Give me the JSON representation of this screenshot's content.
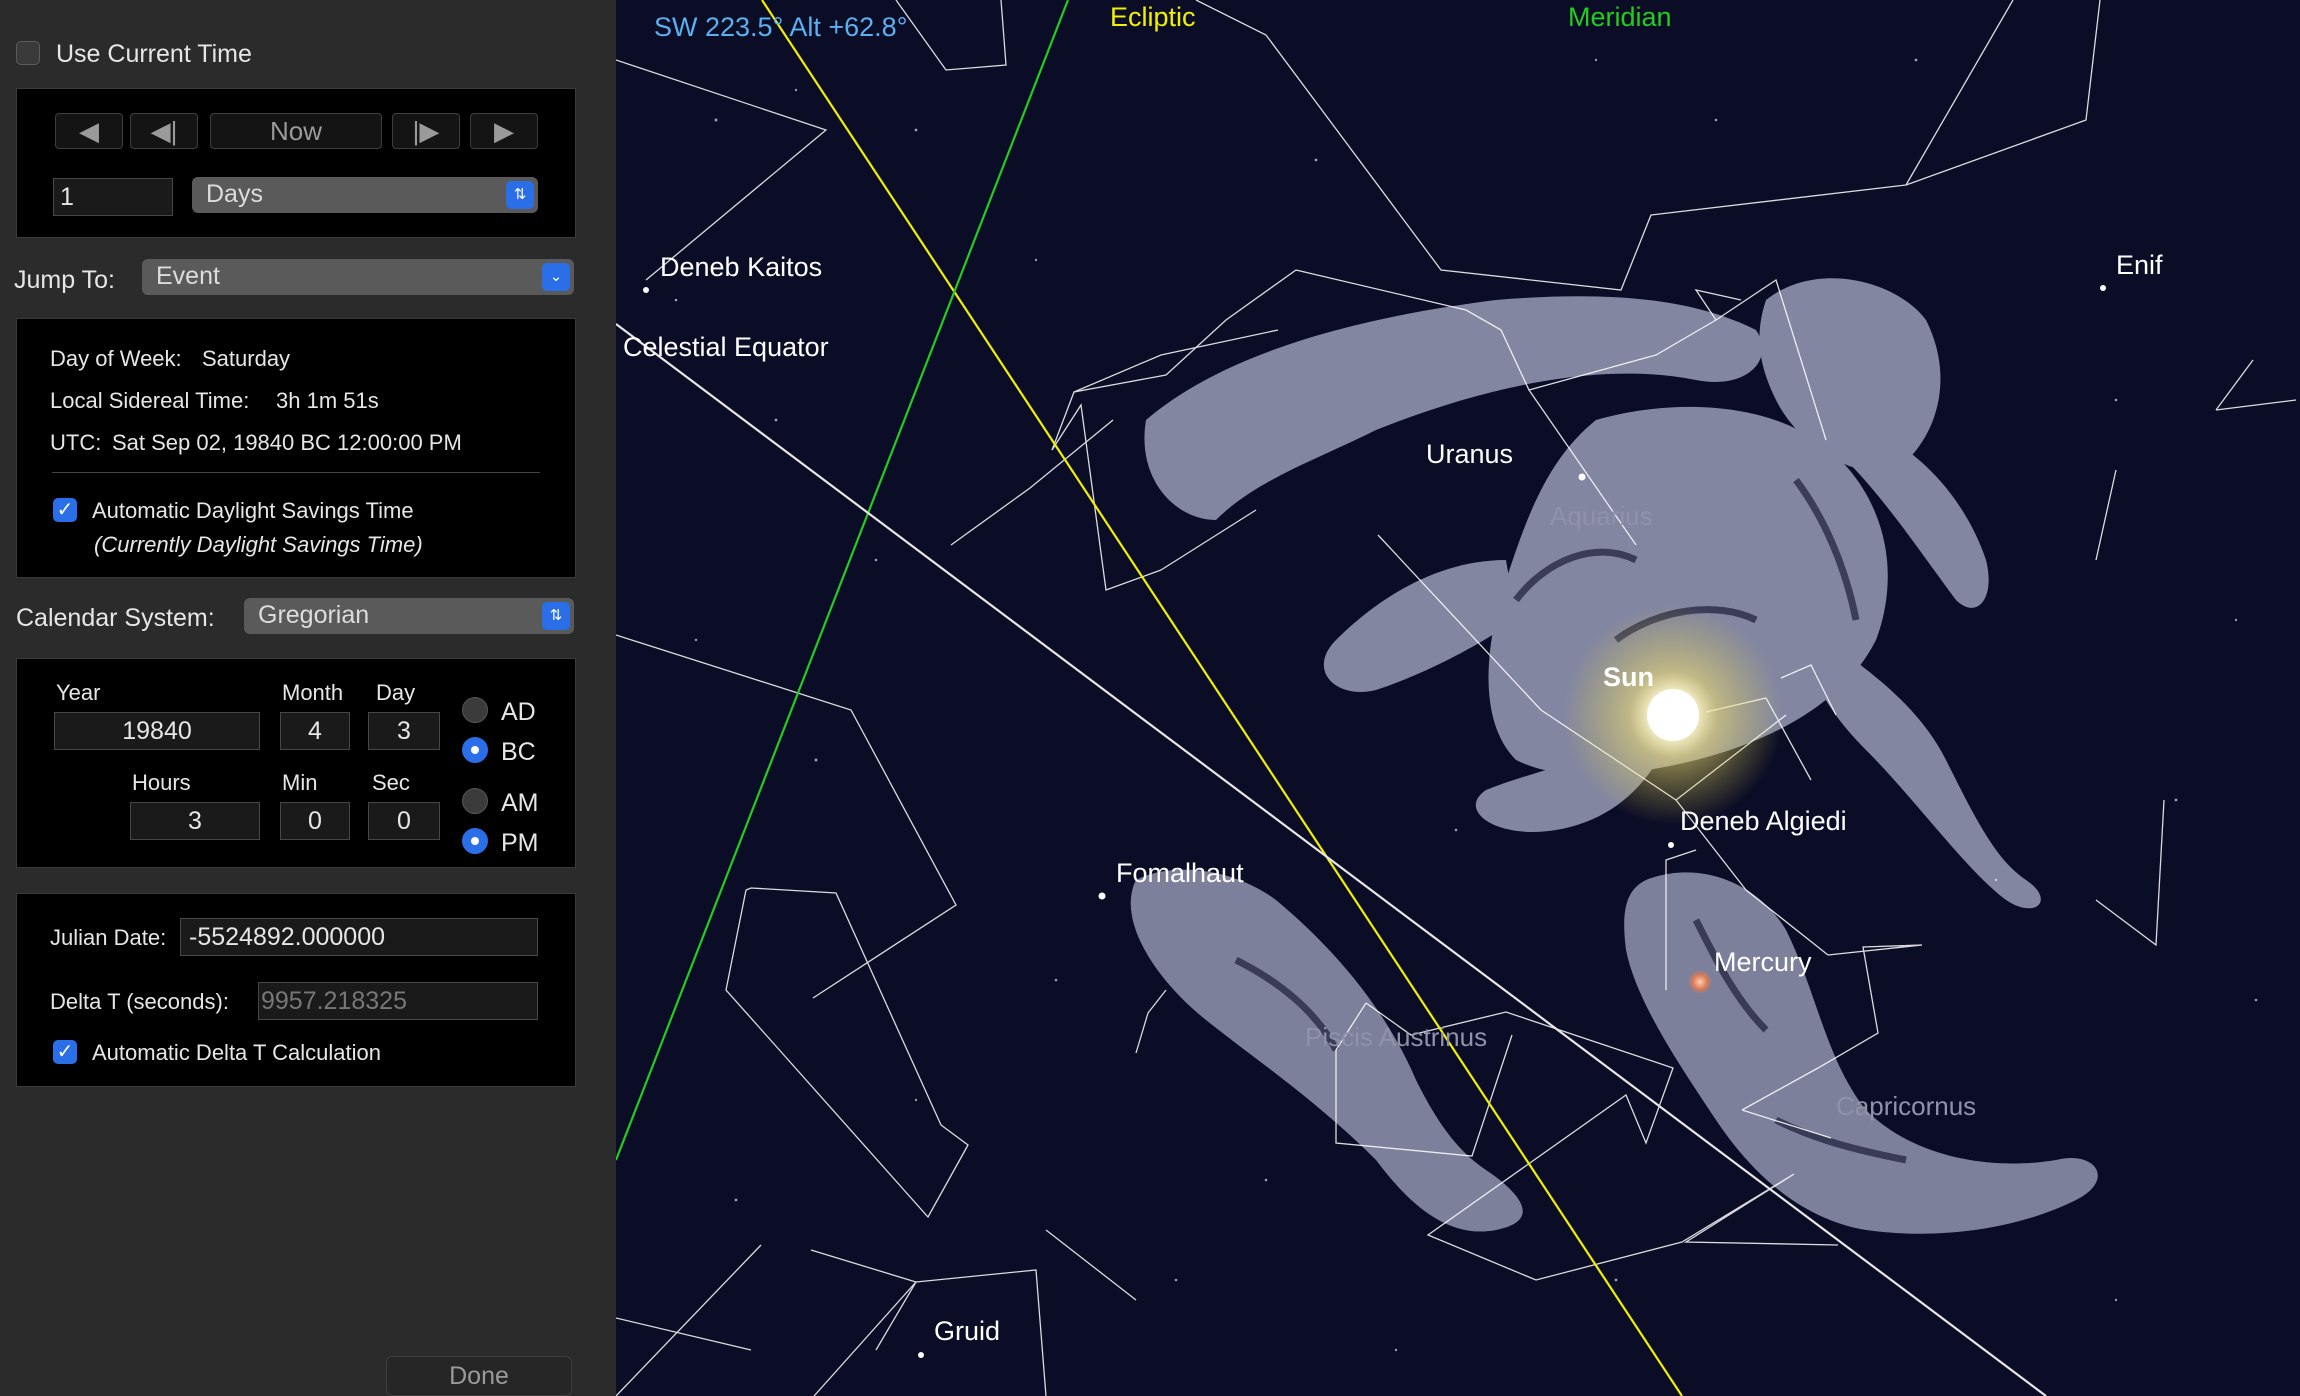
{
  "sidebar": {
    "use_current_time": "Use Current Time",
    "stepper": {
      "now_label": "Now",
      "step_value": "1",
      "step_unit": "Days"
    },
    "jump_to": {
      "label": "Jump To:",
      "value": "Event"
    },
    "info": {
      "day_of_week_label": "Day of Week:",
      "day_of_week": "Saturday",
      "lst_label": "Local Sidereal Time:",
      "lst": "3h 1m 51s",
      "utc_label": "UTC:",
      "utc": "Sat Sep 02, 19840 BC 12:00:00 PM",
      "auto_dst_label": "Automatic Daylight Savings Time",
      "dst_status": "(Currently Daylight Savings Time)"
    },
    "calendar": {
      "label": "Calendar System:",
      "value": "Gregorian"
    },
    "date": {
      "year_label": "Year",
      "year": "19840",
      "month_label": "Month",
      "month": "4",
      "day_label": "Day",
      "day": "3",
      "hours_label": "Hours",
      "hours": "3",
      "min_label": "Min",
      "min": "0",
      "sec_label": "Sec",
      "sec": "0",
      "ad": "AD",
      "bc": "BC",
      "am": "AM",
      "pm": "PM"
    },
    "julian": {
      "label": "Julian Date:",
      "value": "-5524892.000000",
      "delta_t_label": "Delta T (seconds):",
      "delta_t_value": "9957.218325",
      "auto_delta_label": "Automatic Delta T Calculation"
    },
    "done": "Done"
  },
  "sky": {
    "orientation": "SW 223.5° Alt +62.8°",
    "ecliptic": "Ecliptic",
    "meridian": "Meridian",
    "celestial_equator": "Celestial Equator",
    "stars": {
      "deneb_kaitos": "Deneb Kaitos",
      "enif": "Enif",
      "deneb_algiedi": "Deneb Algiedi",
      "fomalhaut": "Fomalhaut",
      "gruid": "Gruid"
    },
    "planets": {
      "uranus": "Uranus",
      "sun": "Sun",
      "mercury": "Mercury"
    },
    "constellations": {
      "aquarius": "Aquarius",
      "piscis_austrinus": "Piscis Austrinus",
      "capricornus": "Capricornus"
    }
  },
  "colors": {
    "sky_bg": "#0b0d26",
    "ecliptic": "#f0f000",
    "meridian": "#22cc22",
    "orientation_text": "#5ab0f0",
    "accent": "#2a6ee8"
  }
}
